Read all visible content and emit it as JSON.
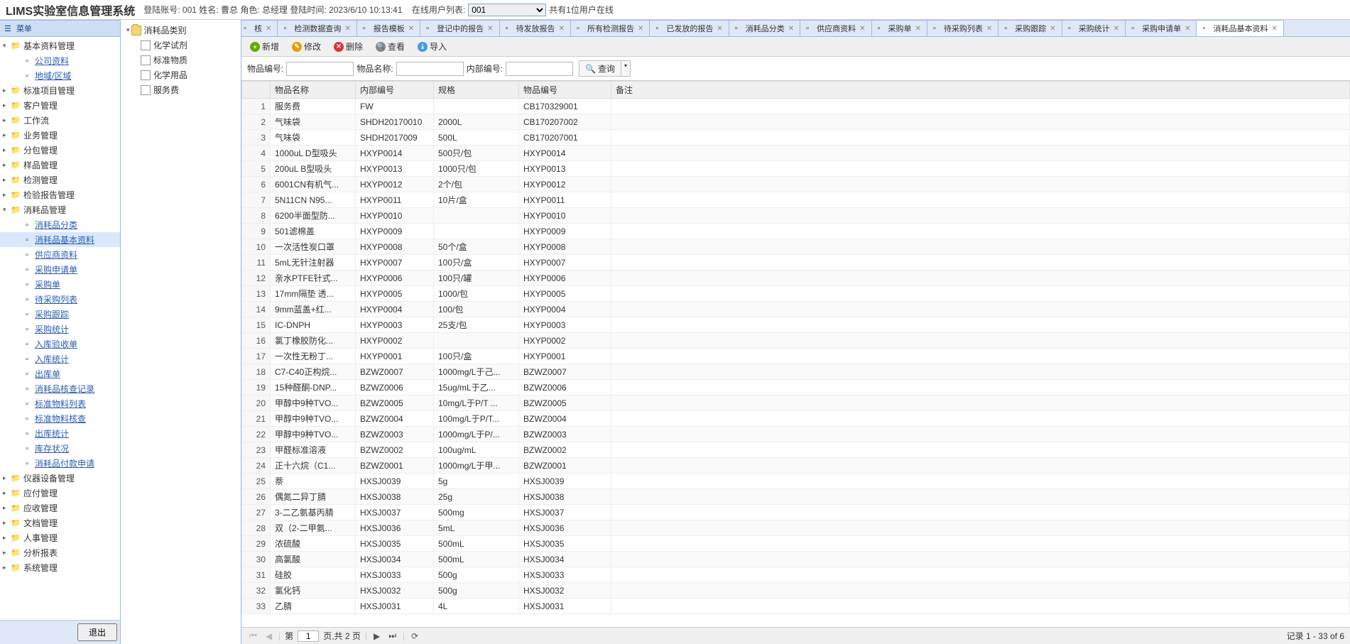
{
  "header": {
    "title": "LIMS实验室信息管理系统",
    "account_label": "登陆账号:",
    "account": "001",
    "name_label": "姓名:",
    "name": "曹总",
    "role_label": "角色:",
    "role": "总经理",
    "login_time_label": "登陆时间:",
    "login_time": "2023/6/10 10:13:41",
    "online_label": "在线用户列表:",
    "online_selected": "001",
    "online_count": "共有1位用户在线"
  },
  "left": {
    "title": "菜单",
    "logout": "退出",
    "nodes": [
      {
        "label": "基本资料管理",
        "expanded": true,
        "children": [
          {
            "label": "公司资料",
            "link": true
          },
          {
            "label": "地域/区域",
            "link": true
          }
        ]
      },
      {
        "label": "标准项目管理"
      },
      {
        "label": "客户管理"
      },
      {
        "label": "工作流"
      },
      {
        "label": "业务管理"
      },
      {
        "label": "分包管理"
      },
      {
        "label": "样品管理"
      },
      {
        "label": "检测管理"
      },
      {
        "label": "检验报告管理"
      },
      {
        "label": "消耗品管理",
        "expanded": true,
        "children": [
          {
            "label": "消耗品分类",
            "link": true
          },
          {
            "label": "消耗品基本资料",
            "link": true,
            "selected": true
          },
          {
            "label": "供应商资料",
            "link": true
          },
          {
            "label": "采购申请单",
            "link": true
          },
          {
            "label": "采购单",
            "link": true
          },
          {
            "label": "待采购列表",
            "link": true
          },
          {
            "label": "采购跟踪",
            "link": true
          },
          {
            "label": "采购统计",
            "link": true
          },
          {
            "label": "入库验收单",
            "link": true
          },
          {
            "label": "入库统计",
            "link": true
          },
          {
            "label": "出库单",
            "link": true
          },
          {
            "label": "消耗品核查记录",
            "link": true
          },
          {
            "label": "标准物料列表",
            "link": true
          },
          {
            "label": "标准物料核查",
            "link": true
          },
          {
            "label": "出库统计",
            "link": true
          },
          {
            "label": "库存状况",
            "link": true
          },
          {
            "label": "消耗品付款申请",
            "link": true
          }
        ]
      },
      {
        "label": "仪器设备管理"
      },
      {
        "label": "应付管理"
      },
      {
        "label": "应收管理"
      },
      {
        "label": "文档管理"
      },
      {
        "label": "人事管理"
      },
      {
        "label": "分析报表"
      },
      {
        "label": "系统管理"
      }
    ]
  },
  "mid": {
    "root": "消耗品类别",
    "items": [
      "化学试剂",
      "标准物质",
      "化学用品",
      "服务费"
    ]
  },
  "tabs": [
    {
      "label": "核",
      "partial": true
    },
    {
      "label": "检测数据查询"
    },
    {
      "label": "报告模板"
    },
    {
      "label": "登记中的报告"
    },
    {
      "label": "待发放报告"
    },
    {
      "label": "所有检测报告"
    },
    {
      "label": "已发放的报告"
    },
    {
      "label": "消耗品分类"
    },
    {
      "label": "供应商资料"
    },
    {
      "label": "采购单"
    },
    {
      "label": "待采购列表"
    },
    {
      "label": "采购跟踪"
    },
    {
      "label": "采购统计"
    },
    {
      "label": "采购申请单"
    },
    {
      "label": "消耗品基本资料",
      "active": true
    }
  ],
  "toolbar": {
    "add": "新增",
    "edit": "修改",
    "del": "删除",
    "view": "查看",
    "import": "导入"
  },
  "search": {
    "f1": "物品编号:",
    "f2": "物品名称:",
    "f3": "内部编号:",
    "btn": "查询"
  },
  "columns": [
    "",
    "物品名称",
    "内部编号",
    "规格",
    "物品编号",
    "备注"
  ],
  "rows": [
    {
      "n": 1,
      "name": "服务费",
      "code": "FW",
      "spec": "",
      "num": "CB170329001"
    },
    {
      "n": 2,
      "name": "气味袋",
      "code": "SHDH20170010",
      "spec": "2000L",
      "num": "CB170207002"
    },
    {
      "n": 3,
      "name": "气味袋",
      "code": "SHDH2017009",
      "spec": "500L",
      "num": "CB170207001"
    },
    {
      "n": 4,
      "name": "1000uL D型吸头",
      "code": "HXYP0014",
      "spec": "500只/包",
      "num": "HXYP0014"
    },
    {
      "n": 5,
      "name": "200uL B型吸头",
      "code": "HXYP0013",
      "spec": "1000只/包",
      "num": "HXYP0013"
    },
    {
      "n": 6,
      "name": "6001CN有机气...",
      "code": "HXYP0012",
      "spec": "2个/包",
      "num": "HXYP0012"
    },
    {
      "n": 7,
      "name": "5N11CN N95...",
      "code": "HXYP0011",
      "spec": "10片/盒",
      "num": "HXYP0011"
    },
    {
      "n": 8,
      "name": "6200半面型防...",
      "code": "HXYP0010",
      "spec": "",
      "num": "HXYP0010"
    },
    {
      "n": 9,
      "name": "501滤棉盖",
      "code": "HXYP0009",
      "spec": "",
      "num": "HXYP0009"
    },
    {
      "n": 10,
      "name": "一次活性炭口罩",
      "code": "HXYP0008",
      "spec": "50个/盒",
      "num": "HXYP0008"
    },
    {
      "n": 11,
      "name": "5mL无针注射器",
      "code": "HXYP0007",
      "spec": "100只/盒",
      "num": "HXYP0007"
    },
    {
      "n": 12,
      "name": "亲水PTFE针式...",
      "code": "HXYP0006",
      "spec": "100只/罐",
      "num": "HXYP0006"
    },
    {
      "n": 13,
      "name": "17mm隔垫 透...",
      "code": "HXYP0005",
      "spec": "1000/包",
      "num": "HXYP0005"
    },
    {
      "n": 14,
      "name": "9mm蓝盖+红...",
      "code": "HXYP0004",
      "spec": "100/包",
      "num": "HXYP0004"
    },
    {
      "n": 15,
      "name": "IC-DNPH",
      "code": "HXYP0003",
      "spec": "25支/包",
      "num": "HXYP0003"
    },
    {
      "n": 16,
      "name": "氯丁橡胶防化...",
      "code": "HXYP0002",
      "spec": "",
      "num": "HXYP0002"
    },
    {
      "n": 17,
      "name": "一次性无粉丁...",
      "code": "HXYP0001",
      "spec": "100只/盒",
      "num": "HXYP0001"
    },
    {
      "n": 18,
      "name": "C7-C40正构烷...",
      "code": "BZWZ0007",
      "spec": "1000mg/L于己...",
      "num": "BZWZ0007"
    },
    {
      "n": 19,
      "name": "15种醛酮-DNP...",
      "code": "BZWZ0006",
      "spec": "15ug/mL于乙...",
      "num": "BZWZ0006"
    },
    {
      "n": 20,
      "name": "甲醇中9种TVO...",
      "code": "BZWZ0005",
      "spec": "10mg/L于P/T ...",
      "num": "BZWZ0005"
    },
    {
      "n": 21,
      "name": "甲醇中9种TVO...",
      "code": "BZWZ0004",
      "spec": "100mg/L于P/T...",
      "num": "BZWZ0004"
    },
    {
      "n": 22,
      "name": "甲醇中9种TVO...",
      "code": "BZWZ0003",
      "spec": "1000mg/L于P/...",
      "num": "BZWZ0003"
    },
    {
      "n": 23,
      "name": "甲醛标准溶液",
      "code": "BZWZ0002",
      "spec": "100ug/mL",
      "num": "BZWZ0002"
    },
    {
      "n": 24,
      "name": "正十六烷（C1...",
      "code": "BZWZ0001",
      "spec": "1000mg/L于甲...",
      "num": "BZWZ0001"
    },
    {
      "n": 25,
      "name": "萘",
      "code": "HXSJ0039",
      "spec": "5g",
      "num": "HXSJ0039"
    },
    {
      "n": 26,
      "name": "偶氮二异丁腈",
      "code": "HXSJ0038",
      "spec": "25g",
      "num": "HXSJ0038"
    },
    {
      "n": 27,
      "name": "3-二乙氨基丙腈",
      "code": "HXSJ0037",
      "spec": "500mg",
      "num": "HXSJ0037"
    },
    {
      "n": 28,
      "name": "双（2-二甲氨...",
      "code": "HXSJ0036",
      "spec": "5mL",
      "num": "HXSJ0036"
    },
    {
      "n": 29,
      "name": "浓硫酸",
      "code": "HXSJ0035",
      "spec": "500mL",
      "num": "HXSJ0035"
    },
    {
      "n": 30,
      "name": "高氯酸",
      "code": "HXSJ0034",
      "spec": "500mL",
      "num": "HXSJ0034"
    },
    {
      "n": 31,
      "name": "硅胶",
      "code": "HXSJ0033",
      "spec": "500g",
      "num": "HXSJ0033"
    },
    {
      "n": 32,
      "name": "氯化钙",
      "code": "HXSJ0032",
      "spec": "500g",
      "num": "HXSJ0032"
    },
    {
      "n": 33,
      "name": "乙腈",
      "code": "HXSJ0031",
      "spec": "4L",
      "num": "HXSJ0031"
    }
  ],
  "pager": {
    "page_label_pre": "第",
    "page": "1",
    "page_label_post": "页,共 2 页",
    "summary": "记录 1 - 33 of 6"
  }
}
